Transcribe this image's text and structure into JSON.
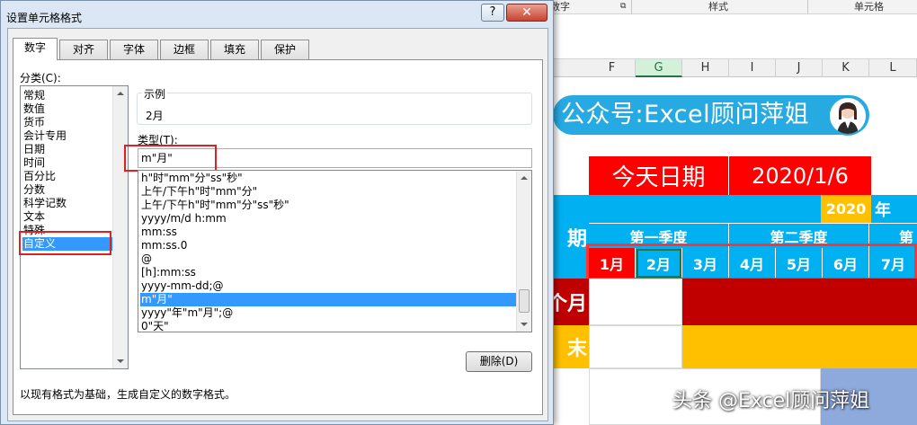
{
  "excel": {
    "ribbon": {
      "number": "数字",
      "styles": "样式",
      "cells": "单元格"
    },
    "columns": [
      {
        "label": "F",
        "selected": false
      },
      {
        "label": "G",
        "selected": true
      },
      {
        "label": "H",
        "selected": false
      },
      {
        "label": "I",
        "selected": false
      },
      {
        "label": "J",
        "selected": false
      },
      {
        "label": "K",
        "selected": false
      },
      {
        "label": "L",
        "selected": false
      }
    ],
    "banner": "公众号:Excel顾问萍姐",
    "today_label": "今天日期",
    "today_value": "2020/1/6",
    "year": "2020",
    "year_unit": "年",
    "quarters": [
      "第一季度",
      "第二季度",
      "第"
    ],
    "row_label_partial": "期",
    "months": [
      "1月",
      "2月",
      "3月",
      "4月",
      "5月",
      "6月",
      "7月"
    ],
    "row_labels_partial": [
      "个月",
      "末"
    ],
    "watermark": "头条 @Excel顾问萍姐"
  },
  "dialog": {
    "title": "设置单元格格式",
    "help": "?",
    "close": "✕",
    "tabs": [
      "数字",
      "对齐",
      "字体",
      "边框",
      "填充",
      "保护"
    ],
    "active_tab": 0,
    "category_label": "分类(C):",
    "categories": [
      "常规",
      "数值",
      "货币",
      "会计专用",
      "日期",
      "时间",
      "百分比",
      "分数",
      "科学记数",
      "文本",
      "特殊",
      "自定义"
    ],
    "selected_category": "自定义",
    "sample_label": "示例",
    "sample_value": "2月",
    "type_label": "类型(T):",
    "type_value": "m\"月\"",
    "formats": [
      "h\"时\"mm\"分\"ss\"秒\"",
      "上午/下午h\"时\"mm\"分\"",
      "上午/下午h\"时\"mm\"分\"ss\"秒\"",
      "yyyy/m/d h:mm",
      "mm:ss",
      "mm:ss.0",
      "@",
      "[h]:mm:ss",
      "yyyy-mm-dd;@",
      "m\"月\"",
      "yyyy\"年\"m\"月\";@",
      "0\"天\""
    ],
    "selected_format": "m\"月\"",
    "delete_button": "删除(D)",
    "description": "以现有格式为基础，生成自定义的数字格式。"
  }
}
